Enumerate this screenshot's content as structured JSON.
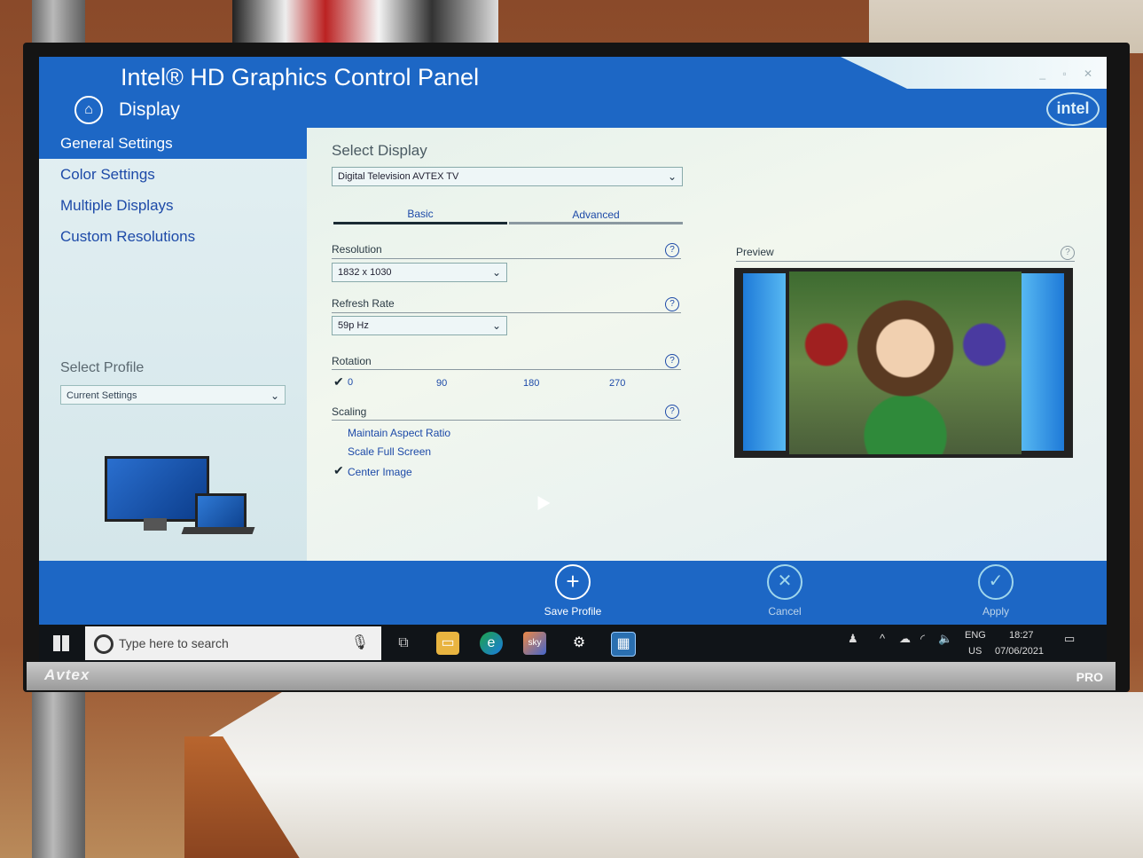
{
  "app": {
    "title": "Intel® HD Graphics Control Panel",
    "section": "Display",
    "logo": "intel",
    "accent_color": "#1d67c5"
  },
  "sidebar": {
    "items": [
      {
        "label": "General Settings",
        "active": true
      },
      {
        "label": "Color Settings",
        "active": false
      },
      {
        "label": "Multiple Displays",
        "active": false
      },
      {
        "label": "Custom Resolutions",
        "active": false
      }
    ],
    "profile_label": "Select Profile",
    "profile_value": "Current Settings"
  },
  "main": {
    "select_display_label": "Select Display",
    "select_display_value": "Digital Television AVTEX TV",
    "tabs": [
      {
        "label": "Basic",
        "active": true
      },
      {
        "label": "Advanced",
        "active": false
      }
    ],
    "resolution": {
      "label": "Resolution",
      "value": "1832 x 1030"
    },
    "refresh_rate": {
      "label": "Refresh Rate",
      "value": "59p Hz"
    },
    "rotation": {
      "label": "Rotation",
      "options": [
        "0",
        "90",
        "180",
        "270"
      ],
      "selected": "0"
    },
    "scaling": {
      "label": "Scaling",
      "options": [
        "Maintain Aspect Ratio",
        "Scale Full Screen",
        "Center Image"
      ],
      "selected": "Center Image"
    },
    "preview_label": "Preview"
  },
  "actions": {
    "save": "Save Profile",
    "cancel": "Cancel",
    "apply": "Apply"
  },
  "taskbar": {
    "search_placeholder": "Type here to search",
    "lang": "ENG",
    "region": "US",
    "time": "18:27",
    "date": "07/06/2021"
  },
  "monitor": {
    "brand": "Avtex",
    "model_badge": "PRO"
  }
}
